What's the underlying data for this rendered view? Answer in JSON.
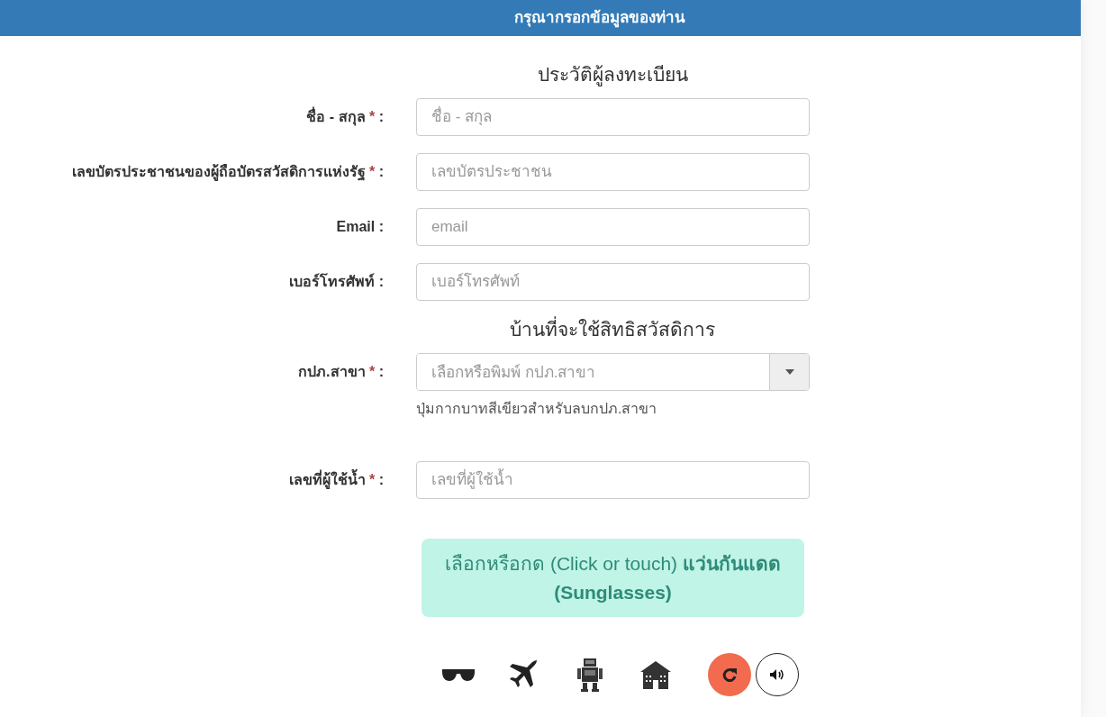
{
  "header": {
    "title": "กรุณากรอกข้อมูลของท่าน"
  },
  "sections": [
    {
      "heading": "ประวัติผู้ลงทะเบียน",
      "fields": [
        {
          "kind": "text",
          "label": "ชื่อ - สกุล",
          "required_mark": "*",
          "colon": ":",
          "placeholder": "ชื่อ - สกุล"
        },
        {
          "kind": "text",
          "label": "เลขบัตรประชาชนของผู้ถือบัตรสวัสดิการแห่งรัฐ",
          "required_mark": "*",
          "colon": ":",
          "placeholder": "เลขบัตรประชาชน"
        },
        {
          "kind": "text",
          "label": "Email",
          "colon": ":",
          "placeholder": "email"
        },
        {
          "kind": "text",
          "label": "เบอร์โทรศัพท์",
          "colon": ":",
          "placeholder": "เบอร์โทรศัพท์"
        }
      ]
    },
    {
      "heading": "บ้านที่จะใช้สิทธิสวัสดิการ",
      "fields": [
        {
          "kind": "select",
          "label": "กปภ.สาขา",
          "required_mark": "*",
          "colon": ":",
          "placeholder": "เลือกหรือพิมพ์ กปภ.สาขา",
          "help": "ปุ่มกากบาทสีเขียวสำหรับลบกปภ.สาขา"
        },
        {
          "kind": "text",
          "label": "เลขที่ผู้ใช้น้ำ",
          "required_mark": "*",
          "colon": ":",
          "placeholder": "เลขที่ผู้ใช้น้ำ"
        }
      ]
    }
  ],
  "captcha": {
    "instruction": "เลือกหรือกด (Click or touch) **แว่นกันแดด (Sunglasses)**",
    "choices": [
      {
        "kind": "sunglasses"
      },
      {
        "kind": "airplane"
      },
      {
        "kind": "robot"
      },
      {
        "kind": "house"
      }
    ],
    "controls": [
      {
        "kind": "refresh"
      },
      {
        "kind": "audio"
      }
    ]
  }
}
